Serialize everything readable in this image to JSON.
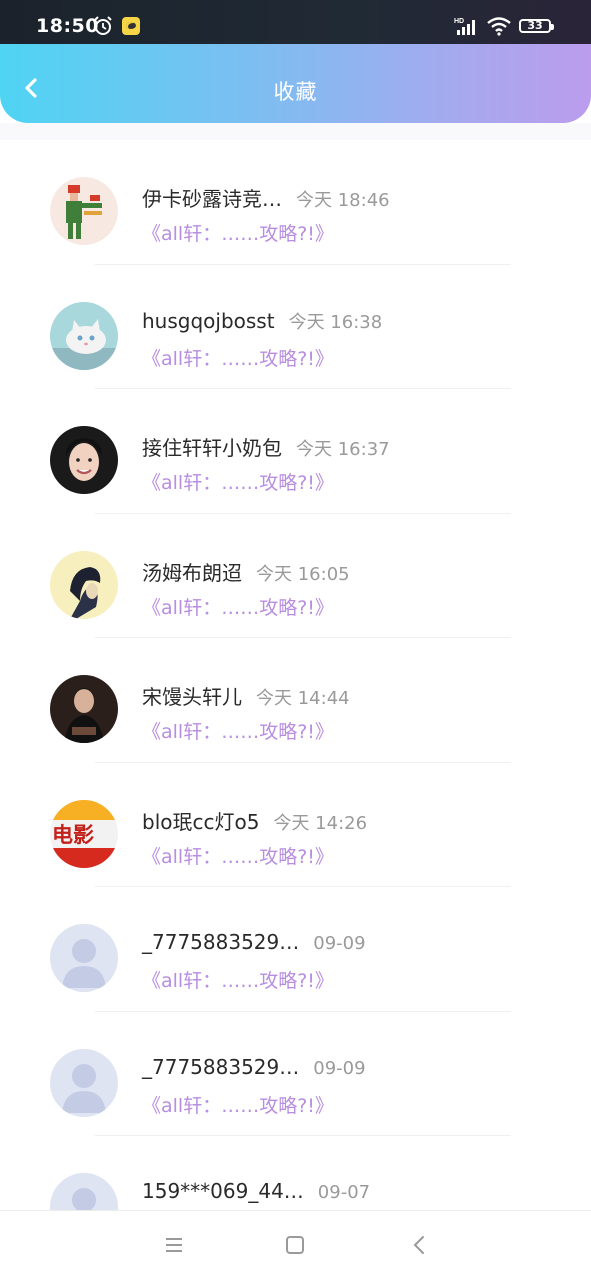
{
  "status_bar": {
    "time": "18:50",
    "battery": "33",
    "icons": [
      "alarm-icon",
      "app-notification-icon",
      "hd-signal-icon",
      "wifi-icon",
      "battery-icon"
    ]
  },
  "header": {
    "title": "收藏",
    "back_icon": "chevron-left-icon",
    "gradient": [
      "#4fd4f3",
      "#bb9ded"
    ]
  },
  "favorites": [
    {
      "name": "伊卡砂露诗竞…",
      "date": "今天 18:46",
      "article": "《all轩：……攻略?!》",
      "avatar": "pixel-character"
    },
    {
      "name": "husgqojbosst",
      "date": "今天 16:38",
      "article": "《all轩：……攻略?!》",
      "avatar": "white-cat"
    },
    {
      "name": "接住轩轩小奶包",
      "date": "今天 16:37",
      "article": "《all轩：……攻略?!》",
      "avatar": "person-smiling"
    },
    {
      "name": "汤姆布朗迢",
      "date": "今天 16:05",
      "article": "《all轩：……攻略?!》",
      "avatar": "person-sketch"
    },
    {
      "name": "宋馒头轩儿",
      "date": "今天 14:44",
      "article": "《all轩：……攻略?!》",
      "avatar": "person-dark"
    },
    {
      "name": "blo珉cc灯o5",
      "date": "今天 14:26",
      "article": "《all轩：……攻略?!》",
      "avatar": "movie-logo"
    },
    {
      "name": "_7775883529…",
      "date": "09-09",
      "article": "《all轩：……攻略?!》",
      "avatar": "default"
    },
    {
      "name": "_7775883529…",
      "date": "09-09",
      "article": "《all轩：……攻略?!》",
      "avatar": "default"
    },
    {
      "name": "159***069_44…",
      "date": "09-07",
      "article": "",
      "avatar": "default"
    }
  ],
  "colors": {
    "article_link": "#b88ee0",
    "name": "#2a2a2a",
    "date": "#9a9a9a"
  },
  "nav_bar": {
    "icons": [
      "menu-icon",
      "home-square-icon",
      "back-triangle-icon"
    ]
  }
}
